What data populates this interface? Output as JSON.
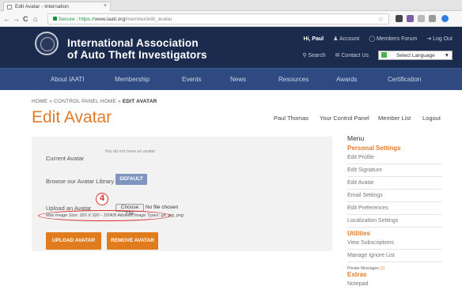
{
  "browser": {
    "tab_title": "Edit Avatar - Internation",
    "tab_close": "×",
    "nav_back": "←",
    "nav_forward": "→",
    "nav_reload": "C",
    "nav_home": "⌂",
    "secure_label": "Secure",
    "url_scheme": "https://",
    "url_host": "www.iaati.org",
    "url_path": "/member/edit_avatar",
    "star": "☆"
  },
  "header": {
    "org_line1": "International Association",
    "org_line2": "of Auto Theft Investigators",
    "greeting": "Hi, Paul",
    "account": "Account",
    "members_forum": "Members Forum",
    "log_out": "Log Out",
    "search": "Search",
    "contact_us": "Contact Us",
    "select_language": "Select Language",
    "lang_caret": "▼"
  },
  "mainnav": {
    "items": [
      "About IAATI",
      "Membership",
      "Events",
      "News",
      "Resources",
      "Awards",
      "Certification"
    ]
  },
  "breadcrumb": {
    "home": "HOME",
    "sep1": " » ",
    "control_panel_home": "CONTROL PANEL HOME",
    "sep2": " » ",
    "current": "EDIT AVATAR"
  },
  "page": {
    "title": "Edit Avatar"
  },
  "usernav": {
    "name": "Paul Thomas",
    "control_panel": "Your Control Panel",
    "member_list": "Member List",
    "logout": "Logout"
  },
  "form": {
    "current_avatar_label": "Current Avatar",
    "no_avatar_text": "You do not have an avatar",
    "browse_label": "Browse our Avatar Library",
    "default_button": "DEFAULT",
    "upload_label": "Upload an Avatar",
    "choose_file": "Choose File",
    "no_file": "No file chosen",
    "limits": "Max Image Size: 320 X 320 - 150KB Allowed Image Types: gif, jpg, png",
    "upload_button": "UPLOAD AVATAR",
    "remove_button": "REMOVE AVATAR"
  },
  "annotation": {
    "step_number": "4",
    "color": "#d32f2f"
  },
  "sidebar": {
    "heading": "Menu",
    "personal_settings": "Personal Settings",
    "personal_links": [
      "Edit Profile",
      "Edit Signature",
      "Edit Avatar",
      "Email Settings",
      "Edit Preferences",
      "Localization Settings"
    ],
    "utilities": "Utilities",
    "utility_links": [
      "View Subscriptions",
      "Manage Ignore List"
    ],
    "private_messages": "Private Messages",
    "pm_count": "(1)",
    "extras": "Extras",
    "extra_links": [
      "Notepad"
    ]
  },
  "colors": {
    "header_bg": "#1b2b4d",
    "nav_bg": "#2e4a80",
    "accent_orange": "#e07b2b",
    "button_blue": "#7f94be",
    "button_orange": "#e07b1e"
  }
}
